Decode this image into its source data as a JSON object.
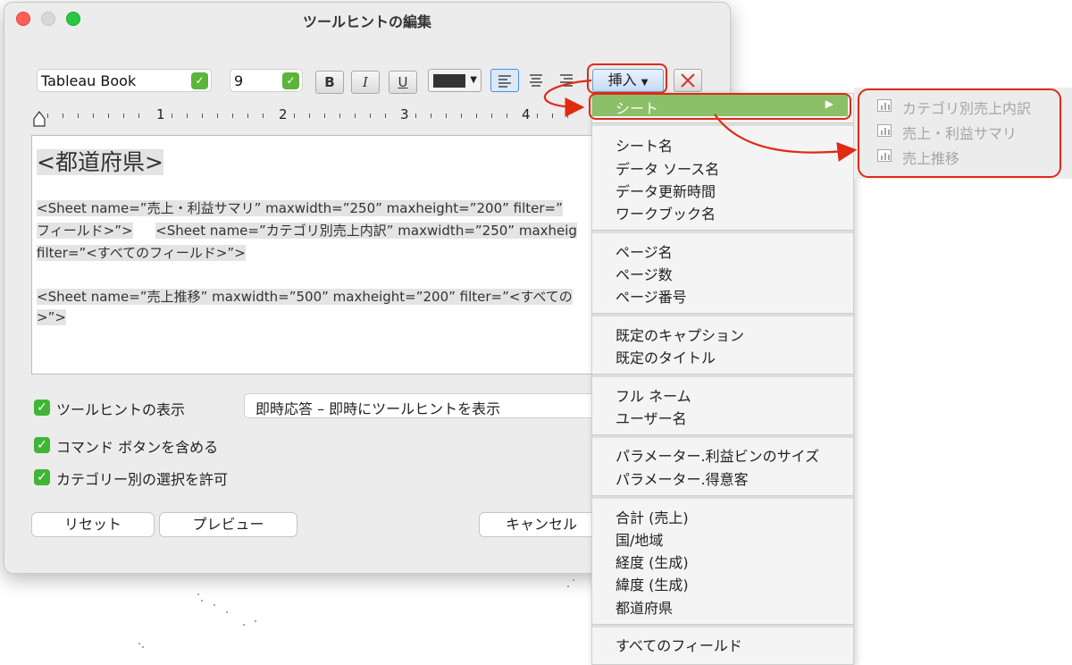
{
  "dialog": {
    "title": "ツールヒントの編集",
    "font_name": "Tableau Book",
    "font_size": "9",
    "bold_label": "B",
    "italic_label": "I",
    "underline_label": "U",
    "insert_label": "挿入",
    "ruler_numbers": [
      "1",
      "2",
      "3",
      "4"
    ],
    "editor": {
      "heading": "<都道府県>",
      "line1": "<Sheet name=”売上・利益サマリ” maxwidth=”250” maxheight=”200” filter=”",
      "line2a": "フィールド>”>",
      "line2b": "<Sheet name=”カテゴリ別売上内訳” maxwidth=”250” maxheig",
      "line3": "filter=”<すべてのフィールド>”>",
      "line4": "<Sheet name=”売上推移” maxwidth=”500” maxheight=”200” filter=”<すべての",
      "line5": ">”>"
    },
    "checkboxes": {
      "show_tooltip": "ツールヒントの表示",
      "include_command_buttons": "コマンド ボタンを含める",
      "allow_category_selection": "カテゴリー別の選択を許可"
    },
    "tooltip_mode": "即時応答 – 即時にツールヒントを表示",
    "buttons": {
      "reset": "リセット",
      "preview": "プレビュー",
      "cancel": "キャンセル"
    }
  },
  "insert_menu": {
    "sheet_item": "シート",
    "sheet_arrow": "▶",
    "groups": [
      [
        "シート名",
        "データ ソース名",
        "データ更新時間",
        "ワークブック名"
      ],
      [
        "ページ名",
        "ページ数",
        "ページ番号"
      ],
      [
        "既定のキャプション",
        "既定のタイトル"
      ],
      [
        "フル ネーム",
        "ユーザー名"
      ],
      [
        "パラメーター.利益ビンのサイズ",
        "パラメーター.得意客"
      ],
      [
        "合計 (売上)",
        "国/地域",
        "経度 (生成)",
        "緯度 (生成)",
        "都道府県"
      ],
      [
        "すべてのフィールド"
      ]
    ]
  },
  "sheet_submenu": {
    "items": [
      "カテゴリ別売上内訳",
      "売上・利益サマリ",
      "売上推移"
    ]
  },
  "colors": {
    "accent_green": "#5cb53a",
    "highlight_green": "#8bbf68",
    "annotation_red": "#e02a14",
    "text_color_swatch": "#333333"
  }
}
